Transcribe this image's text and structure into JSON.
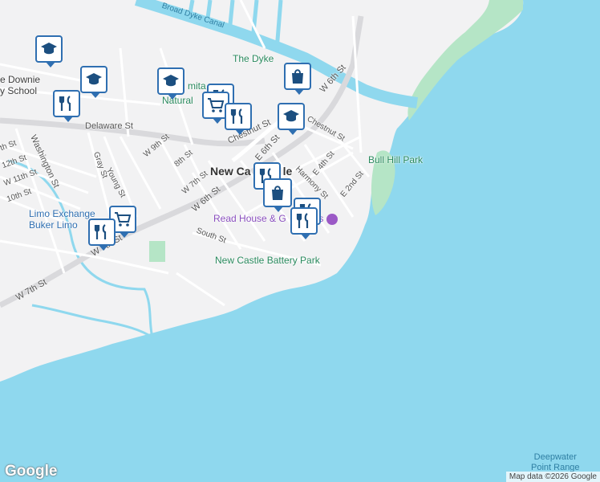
{
  "map": {
    "labels": {
      "broad_dyke_canal": "Broad Dyke Canal",
      "the_dyke": "The Dyke",
      "downie_school": "e Downie\ny School",
      "natural": "Natural",
      "mita": "mita",
      "delaware_st": "Delaware St",
      "washington_st": "Washington St",
      "th_st": "th St",
      "twelfth_st": "12th St",
      "eleventh_st": "W 11th St",
      "tenth_st": "10th St",
      "gray_st": "Gray St",
      "young_st": "Young St",
      "w9th_st": "W 9th St",
      "eighth_st": "8th St",
      "w7th_st_a": "W 7th St",
      "w6th_st_a": "W 6th St",
      "w6th_st_b": "W 6th St",
      "e6th_st": "E 6th St",
      "chestnut_st_a": "Chestnut St",
      "chestnut_st_b": "Chestnut St",
      "e4th_st": "E 4th St",
      "harmony_st": "Harmony St",
      "e2nd_st": "E 2nd St",
      "south_st": "South St",
      "w7th_st_b": "W 7th St",
      "w7th_st_c": "W 7th St",
      "new_castle": "New Ca",
      "new_castle_suffix": "le",
      "limo_line1": "Limo Exchange",
      "limo_line2": "Buker Limo",
      "bull_hill_park": "Bull Hill Park",
      "read_house": "Read House & G",
      "read_house_suffix": "ns",
      "battery_park": "New Castle Battery Park",
      "deepwater": "Deepwater\nPoint Range"
    },
    "pins": [
      {
        "icon": "school-icon"
      },
      {
        "icon": "school-icon"
      },
      {
        "icon": "school-icon"
      },
      {
        "icon": "restaurant-icon"
      },
      {
        "icon": "restaurant-icon"
      },
      {
        "icon": "restaurant-icon"
      },
      {
        "icon": "restaurant-icon"
      },
      {
        "icon": "restaurant-icon"
      },
      {
        "icon": "restaurant-icon"
      },
      {
        "icon": "shopping-bag-icon"
      },
      {
        "icon": "shopping-bag-icon"
      },
      {
        "icon": "shopping-cart-icon"
      },
      {
        "icon": "shopping-cart-icon"
      },
      {
        "icon": "school-icon"
      }
    ],
    "attribution": "Map data ©2026 Google",
    "logo": "Google",
    "colors": {
      "water": "#8fd8ee",
      "land": "#f2f2f3",
      "park": "#b5e5c6",
      "pin_border": "#2f6fb1"
    }
  }
}
